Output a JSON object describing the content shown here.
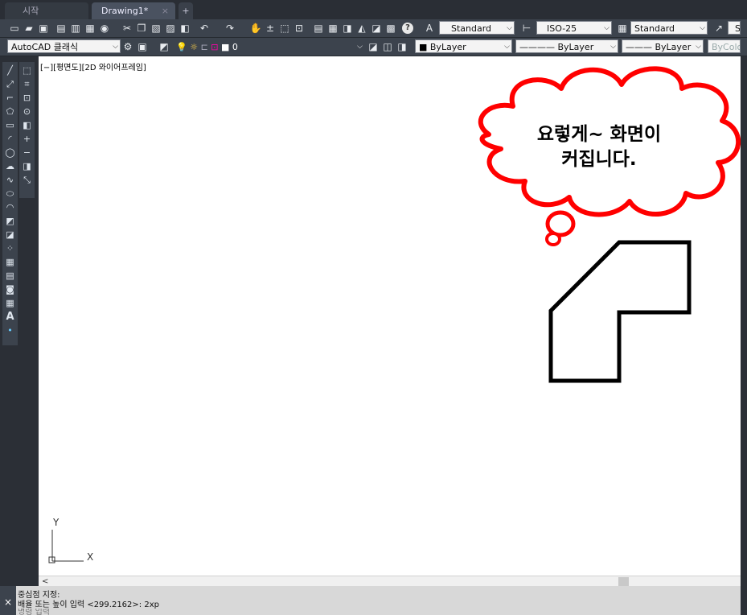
{
  "tabs": {
    "start": "시작",
    "drawing": "Drawing1*",
    "close": "×",
    "new": "+"
  },
  "toolbar1": {
    "help": "?",
    "text_style": "Standard",
    "dim_style": "ISO-25",
    "table_style": "Standard",
    "multileader_style_partial": "S"
  },
  "toolbar2": {
    "workspace": "AutoCAD 클래식",
    "layer": "0",
    "color": "ByLayer",
    "linetype": "ByLayer",
    "lineweight": "ByLayer",
    "plotstyle": "ByColor"
  },
  "canvas": {
    "view_label": "[−][평면도][2D 와이어프레임]",
    "callout_line1": "요렇게~ 화면이",
    "callout_line2": "커집니다.",
    "ucs_y": "Y",
    "ucs_x": "X"
  },
  "hscroll": {
    "left_arrow": "<"
  },
  "command": {
    "line1": "중심점 지정:",
    "line2": "배율 또는 높이 입력 <299.2162>: 2xp",
    "line3": "명령 입력",
    "close": "×"
  },
  "colors": {
    "callout": "#ff0000",
    "shape": "#000000",
    "canvas": "#ffffff"
  }
}
